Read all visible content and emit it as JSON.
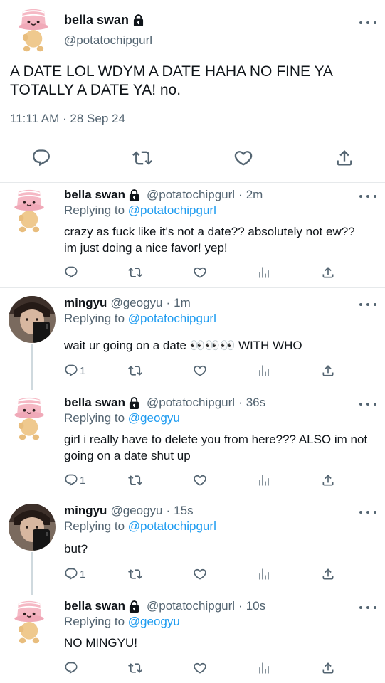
{
  "main_tweet": {
    "name": "bella swan",
    "handle": "@potatochipgurl",
    "text": "A DATE LOL WDYM A DATE HAHA NO FINE YA TOTALLY A DATE YA! no.",
    "timestamp": "11:11 AM · 28 Sep 24",
    "protected": true
  },
  "replies": [
    {
      "name": "bella swan",
      "handle": "@potatochipgurl",
      "time": "2m",
      "replying_label": "Replying to",
      "replying_to": "@potatochipgurl",
      "text": "crazy as fuck like it's not a date?? absolutely not ew?? im just doing a nice favor! yep!",
      "reply_count": "",
      "protected": true,
      "avatar": "potato-avatar"
    },
    {
      "name": "mingyu",
      "handle": "@geogyu",
      "time": "1m",
      "replying_label": "Replying to",
      "replying_to": "@potatochipgurl",
      "text": "wait ur going on a date 👀👀👀 WITH WHO",
      "reply_count": "1",
      "protected": false,
      "avatar": "photo-avatar"
    },
    {
      "name": "bella swan",
      "handle": "@potatochipgurl",
      "time": "36s",
      "replying_label": "Replying to",
      "replying_to": "@geogyu",
      "text": "girl i really have to delete you from here??? ALSO im not going on a date shut up",
      "reply_count": "1",
      "protected": true,
      "avatar": "potato-avatar"
    },
    {
      "name": "mingyu",
      "handle": "@geogyu",
      "time": "15s",
      "replying_label": "Replying to",
      "replying_to": "@potatochipgurl",
      "text": "but?",
      "reply_count": "1",
      "protected": false,
      "avatar": "photo-avatar"
    },
    {
      "name": "bella swan",
      "handle": "@potatochipgurl",
      "time": "10s",
      "replying_label": "Replying to",
      "replying_to": "@geogyu",
      "text": "NO MINGYU!",
      "reply_count": "",
      "protected": true,
      "avatar": "potato-avatar"
    }
  ],
  "icons": {
    "reply": "reply-icon",
    "retweet": "retweet-icon",
    "like": "heart-icon",
    "analytics": "analytics-icon",
    "share": "share-icon",
    "more": "more-icon",
    "lock": "lock-icon"
  },
  "colors": {
    "text": "#0f1419",
    "secondary": "#536471",
    "link": "#1d9bf0",
    "divider": "#e6e9eb",
    "thread_line": "#cfd9de"
  }
}
